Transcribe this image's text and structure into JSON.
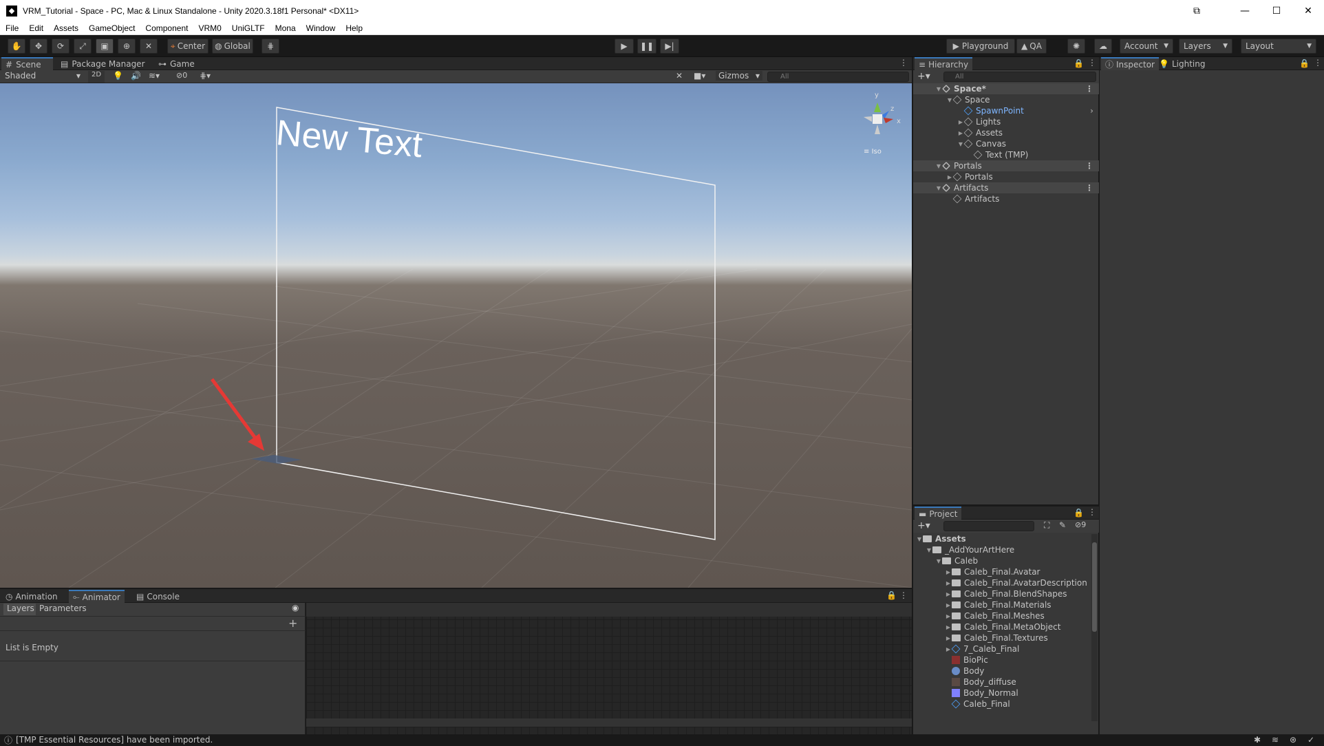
{
  "window": {
    "title": "VRM_Tutorial - Space - PC, Mac & Linux Standalone - Unity 2020.3.18f1 Personal* <DX11>"
  },
  "menu": [
    "File",
    "Edit",
    "Assets",
    "GameObject",
    "Component",
    "VRM0",
    "UniGLTF",
    "Mona",
    "Window",
    "Help"
  ],
  "toolbar": {
    "pivot_label": "Center",
    "space_label": "Global",
    "playground_label": "Playground",
    "qa_label": "QA",
    "account_label": "Account",
    "layers_label": "Layers",
    "layout_label": "Layout"
  },
  "scene_tabs": [
    "Scene",
    "Package Manager",
    "Game"
  ],
  "scene_bar": {
    "draw_mode": "Shaded",
    "two_d": "2D",
    "hidden_count": "0",
    "gizmos_label": "Gizmos",
    "search_placeholder": "All"
  },
  "scene_view": {
    "text_object": "New Text",
    "iso_label": "Iso",
    "axis_y": "y",
    "axis_z": "z",
    "axis_x": "x"
  },
  "hierarchy": {
    "tab": "Hierarchy",
    "search_placeholder": "All",
    "items": [
      {
        "label": "Space*",
        "type": "scene"
      },
      {
        "label": "Space",
        "type": "object"
      },
      {
        "label": "SpawnPoint",
        "type": "prefab"
      },
      {
        "label": "Lights",
        "type": "object"
      },
      {
        "label": "Assets",
        "type": "object"
      },
      {
        "label": "Canvas",
        "type": "object"
      },
      {
        "label": "Text (TMP)",
        "type": "object"
      },
      {
        "label": "Portals",
        "type": "scene"
      },
      {
        "label": "Portals",
        "type": "object"
      },
      {
        "label": "Artifacts",
        "type": "scene"
      },
      {
        "label": "Artifacts",
        "type": "object"
      }
    ]
  },
  "inspector_tabs": [
    "Inspector",
    "Lighting"
  ],
  "project": {
    "tab": "Project",
    "hidden_count": "9",
    "items": [
      {
        "label": "Assets",
        "type": "folder-root"
      },
      {
        "label": "_AddYourArtHere",
        "type": "folder-open"
      },
      {
        "label": "Caleb",
        "type": "folder-open"
      },
      {
        "label": "Caleb_Final.Avatar",
        "type": "folder"
      },
      {
        "label": "Caleb_Final.AvatarDescription",
        "type": "folder"
      },
      {
        "label": "Caleb_Final.BlendShapes",
        "type": "folder"
      },
      {
        "label": "Caleb_Final.Materials",
        "type": "folder"
      },
      {
        "label": "Caleb_Final.Meshes",
        "type": "folder"
      },
      {
        "label": "Caleb_Final.MetaObject",
        "type": "folder"
      },
      {
        "label": "Caleb_Final.Textures",
        "type": "folder"
      },
      {
        "label": "7_Caleb_Final",
        "type": "prefab"
      },
      {
        "label": "BioPic",
        "type": "image"
      },
      {
        "label": "Body",
        "type": "material"
      },
      {
        "label": "Body_diffuse",
        "type": "texture"
      },
      {
        "label": "Body_Normal",
        "type": "normal"
      },
      {
        "label": "Caleb_Final",
        "type": "prefab"
      }
    ]
  },
  "bottom_tabs": [
    "Animation",
    "Animator",
    "Console"
  ],
  "animator": {
    "layers_tab": "Layers",
    "parameters_tab": "Parameters",
    "empty_text": "List is Empty"
  },
  "status": {
    "message": "[TMP Essential Resources] have been imported."
  },
  "colors": {
    "accent": "#3a79bb",
    "sky_top": "#7a97c0",
    "ground": "#5e5550",
    "arrow": "#e53935"
  }
}
